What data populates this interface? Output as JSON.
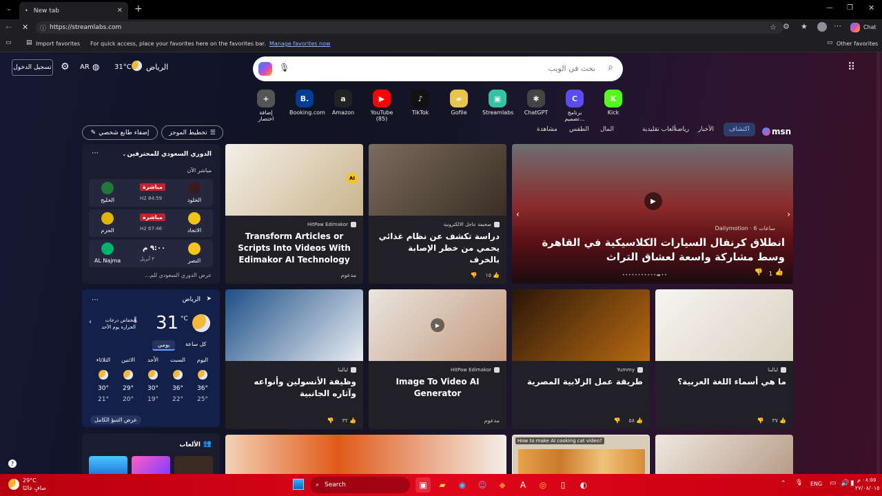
{
  "browser": {
    "tab_title": "New tab",
    "url": "https://streamlabs.com",
    "chat_label": "Chat",
    "fav_import": "Import favorites",
    "fav_hint": "For quick access, place your favorites here on the favorites bar.",
    "fav_manage": "Manage favorites now",
    "fav_other": "Other favorites"
  },
  "header": {
    "signin": "تسجيل الدخول",
    "lang": "AR",
    "temp": "31°C",
    "city": "الرياض",
    "search_placeholder": "بحث في الويب"
  },
  "shortcuts": [
    {
      "label": "Kick",
      "glyph": "K",
      "color": "#53fc18"
    },
    {
      "label": "برنامج تصميم...",
      "glyph": "C",
      "color": "#5a4cf0"
    },
    {
      "label": "ChatGPT",
      "glyph": "✱",
      "color": "#444"
    },
    {
      "label": "Streamlabs",
      "glyph": "▣",
      "color": "#31c3a2"
    },
    {
      "label": "Gofile",
      "glyph": "▰",
      "color": "#e9c44a"
    },
    {
      "label": "TikTok",
      "glyph": "♪",
      "color": "#111"
    },
    {
      "label": "YouTube (85)",
      "glyph": "▶",
      "color": "#ff0000"
    },
    {
      "label": "Amazon",
      "glyph": "a",
      "color": "#222"
    },
    {
      "label": "Booking.com",
      "glyph": "B.",
      "color": "#003b95"
    },
    {
      "label": "إضافة اختصار",
      "glyph": "+",
      "color": "#555"
    }
  ],
  "feednav": {
    "brand": "msn",
    "items": [
      "اكتشاف",
      "الأخبار",
      "رياضة",
      "ألعاب تقليدية",
      "المال",
      "الطقس",
      "مشاهدة"
    ],
    "layout": "تخطيط الموجز",
    "personalize": "إضفاء طابع شخصي"
  },
  "sports": {
    "title": "الدوري السعودي للمحترفين",
    "live": "مباشر الآن",
    "matches": [
      {
        "home": "الخلود",
        "away": "الخليج",
        "status": "مباشرة",
        "time": "H2 84:59"
      },
      {
        "home": "الاتحاد",
        "away": "الحزم",
        "status": "مباشرة",
        "time": "H2 67:46"
      },
      {
        "home": "النصر",
        "away": "AL Najma",
        "status": "٩:٠٠ م",
        "time": "٣ أبريل"
      }
    ],
    "more": "عرض الدوري السعودي للم..."
  },
  "weather": {
    "city": "الرياض",
    "temp": "31",
    "unit": "°C",
    "alert": "انخفاض درجات الحرارة يوم الأحد",
    "tab_hourly": "كل ساعة",
    "tab_daily": "يومي",
    "days": [
      {
        "d": "اليوم",
        "hi": "36°",
        "lo": "25°"
      },
      {
        "d": "السبت",
        "hi": "36°",
        "lo": "22°"
      },
      {
        "d": "الأحد",
        "hi": "30°",
        "lo": "19°"
      },
      {
        "d": "الاثنين",
        "hi": "29°",
        "lo": "20°"
      },
      {
        "d": "الثلاثاء",
        "hi": "30°",
        "lo": "21°"
      }
    ],
    "more": "عرض التنبؤ الكامل"
  },
  "games": {
    "title": "الألعاب"
  },
  "hero": {
    "source": "Dailymotion · 6 ساعات",
    "title": "انطلاق كرنفال السيارات الكلاسيكية في القاهرة وسط مشاركة واسعة لعشاق التراث",
    "likes": "1"
  },
  "cards": [
    {
      "source": "صحيفة عاجل الالكترونية",
      "title": "دراسة تكشف عن نظام غذائي يحمي من خطر الإصابة بالخرف",
      "likes": "١٥",
      "foot": ""
    },
    {
      "source": "HitPaw Edimakor",
      "title": "Transform Articles or Scripts Into Videos With Edimakor AI Technology",
      "likes": "",
      "foot": "مدعوم"
    },
    {
      "source": "ليالينا",
      "title": "ما هي أسماء اللغة العربية؟",
      "likes": "٣٧",
      "foot": ""
    },
    {
      "source": "Yummy",
      "title": "طريقة عمل الزلابية المصرية",
      "likes": "٥٨",
      "foot": ""
    },
    {
      "source": "HitPaw Edimakor",
      "title": "Image To Video AI Generator",
      "likes": "",
      "foot": "مدعوم"
    },
    {
      "source": "ليالينا",
      "title": "وظيفة الأنسولين وأنواعه وآثاره الجانبية",
      "likes": "٣٢",
      "foot": ""
    }
  ],
  "bottom_card": {
    "title": "How to make AI cooking cat video?"
  },
  "taskbar": {
    "weather_temp": "29°C",
    "weather_desc": "صافٍ غالبًا",
    "search": "Search",
    "lang": "ENG",
    "time": "٠٨:٥٥ م",
    "date": "٢٧/٠٨/٠١٥"
  }
}
